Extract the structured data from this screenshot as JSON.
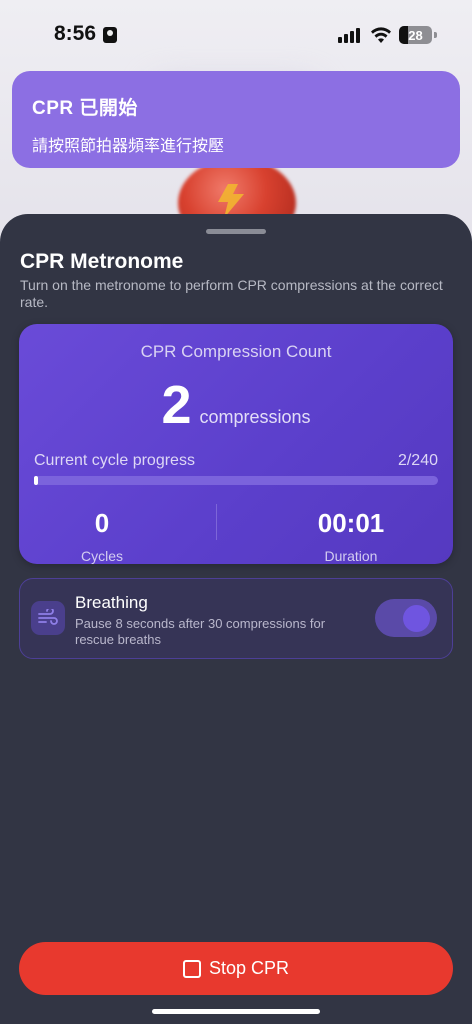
{
  "status_bar": {
    "time": "8:56",
    "battery": "28"
  },
  "banner": {
    "title": "CPR 已開始",
    "body": "請按照節拍器頻率進行按壓"
  },
  "sheet": {
    "title": "CPR Metronome",
    "subtitle": "Turn on the metronome to perform CPR compressions at the correct rate."
  },
  "count_card": {
    "label": "CPR Compression Count",
    "count": "2",
    "unit": "compressions",
    "progress_label": "Current cycle progress",
    "progress_text": "2/240",
    "progress_fraction": 0.0083,
    "cycles_value": "0",
    "cycles_label": "Cycles",
    "duration_value": "00:01",
    "duration_label": "Duration"
  },
  "breathing": {
    "title": "Breathing",
    "description": "Pause 8 seconds after 30 compressions for rescue breaths",
    "enabled": true,
    "icon": "wind-icon"
  },
  "actions": {
    "stop_label": "Stop CPR"
  },
  "colors": {
    "accent": "#6a4bd8",
    "banner": "#8c6fe3",
    "sheet_bg": "#323544",
    "stop_button": "#e8392e"
  }
}
